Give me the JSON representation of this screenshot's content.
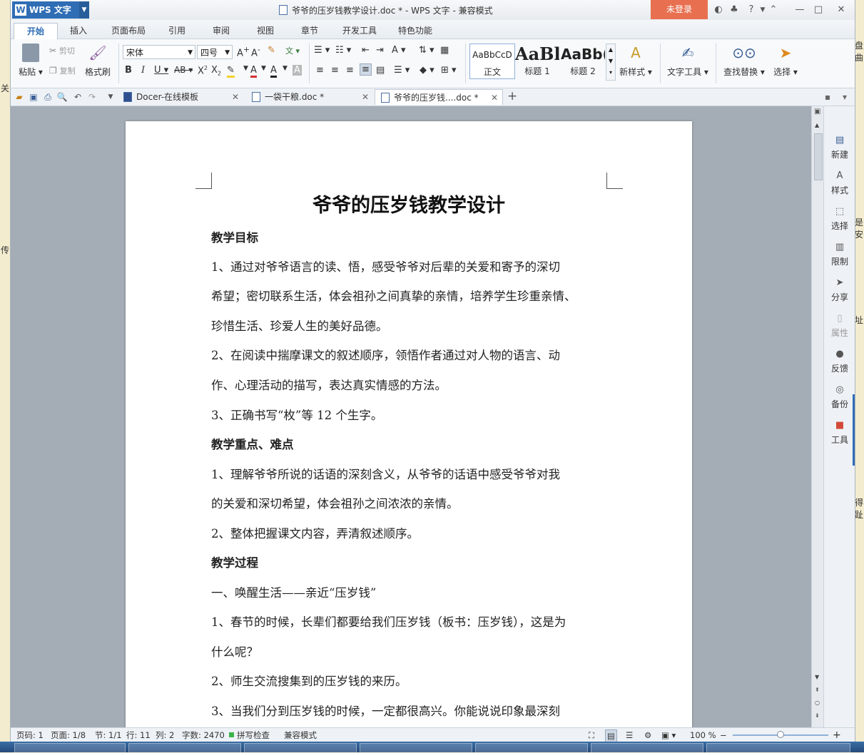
{
  "background_fragments": [
    "关",
    "传",
    "盘曲",
    "是安",
    "址",
    "得趾"
  ],
  "app": {
    "name": "WPS 文字",
    "logo_letter": "W",
    "window_title": "爷爷的压岁钱教学设计.doc * - WPS 文字 - 兼容模式",
    "login_label": "未登录",
    "help_label": "?"
  },
  "menu": {
    "tabs": [
      "开始",
      "插入",
      "页面布局",
      "引用",
      "审阅",
      "视图",
      "章节",
      "开发工具",
      "特色功能"
    ],
    "active": "开始"
  },
  "ribbon": {
    "paste_label": "粘贴",
    "cut_label": "剪切",
    "copy_label": "复制",
    "format_painter_label": "格式刷",
    "font_name": "宋体",
    "font_size": "四号",
    "styles": [
      {
        "preview": "AaBbCcD",
        "label": "正文"
      },
      {
        "preview": "AaBl",
        "label": "标题 1"
      },
      {
        "preview": "AaBb(",
        "label": "标题 2"
      }
    ],
    "new_style_label": "新样式",
    "text_tools_label": "文字工具",
    "find_replace_label": "查找替换",
    "select_label": "选择"
  },
  "doc_tabs": [
    {
      "label": "Docer-在线模板",
      "active": false
    },
    {
      "label": "一袋干粮.doc *",
      "active": false
    },
    {
      "label": "爷爷的压岁钱....doc *",
      "active": true
    }
  ],
  "document": {
    "title": "爷爷的压岁钱教学设计",
    "lines": [
      {
        "text": "教学目标",
        "bold": true
      },
      {
        "text": "1、通过对爷爷语言的读、悟，感受爷爷对后辈的关爱和寄予的深切",
        "bold": false
      },
      {
        "text": "希望；密切联系生活，体会祖孙之间真挚的亲情，培养学生珍重亲情、",
        "bold": false
      },
      {
        "text": "珍惜生活、珍爱人生的美好品德。",
        "bold": false
      },
      {
        "text": "2、在阅读中揣摩课文的叙述顺序，领悟作者通过对人物的语言、动",
        "bold": false
      },
      {
        "text": "作、心理活动的描写，表达真实情感的方法。",
        "bold": false
      },
      {
        "text": "3、正确书写“枚”等 12 个生字。",
        "bold": false
      },
      {
        "text": "教学重点、难点",
        "bold": true
      },
      {
        "text": "1、理解爷爷所说的话语的深刻含义，从爷爷的话语中感受爷爷对我",
        "bold": false
      },
      {
        "text": "的关爱和深切希望，体会祖孙之间浓浓的亲情。",
        "bold": false
      },
      {
        "text": "2、整体把握课文内容，弄清叙述顺序。",
        "bold": false
      },
      {
        "text": "教学过程",
        "bold": true
      },
      {
        "text": "一、唤醒生活——亲近“压岁钱”",
        "bold": false
      },
      {
        "text": "1、春节的时候，长辈们都要给我们压岁钱（板书：压岁钱），这是为",
        "bold": false
      },
      {
        "text": "什么呢？",
        "bold": false
      },
      {
        "text": "2、师生交流搜集到的压岁钱的来历。",
        "bold": false
      },
      {
        "text": "3、当我们分到压岁钱的时候，一定都很高兴。你能说说印象最深刻",
        "bold": false
      }
    ]
  },
  "sidebar": {
    "items": [
      "新建",
      "样式",
      "选择",
      "限制",
      "分享",
      "属性",
      "反馈",
      "备份",
      "工具"
    ]
  },
  "status": {
    "page_code": "页码: 1",
    "pages": "页面: 1/8",
    "section": "节: 1/1",
    "row": "行: 11",
    "col": "列: 2",
    "word_count": "字数: 2470",
    "spell_check": "拼写检查",
    "compat_mode": "兼容模式",
    "zoom": "100 %",
    "zoom_fraction": 0.5
  },
  "colors": {
    "accent": "#2f6db5",
    "login": "#e86f50",
    "page_bg": "#a4acb6"
  }
}
